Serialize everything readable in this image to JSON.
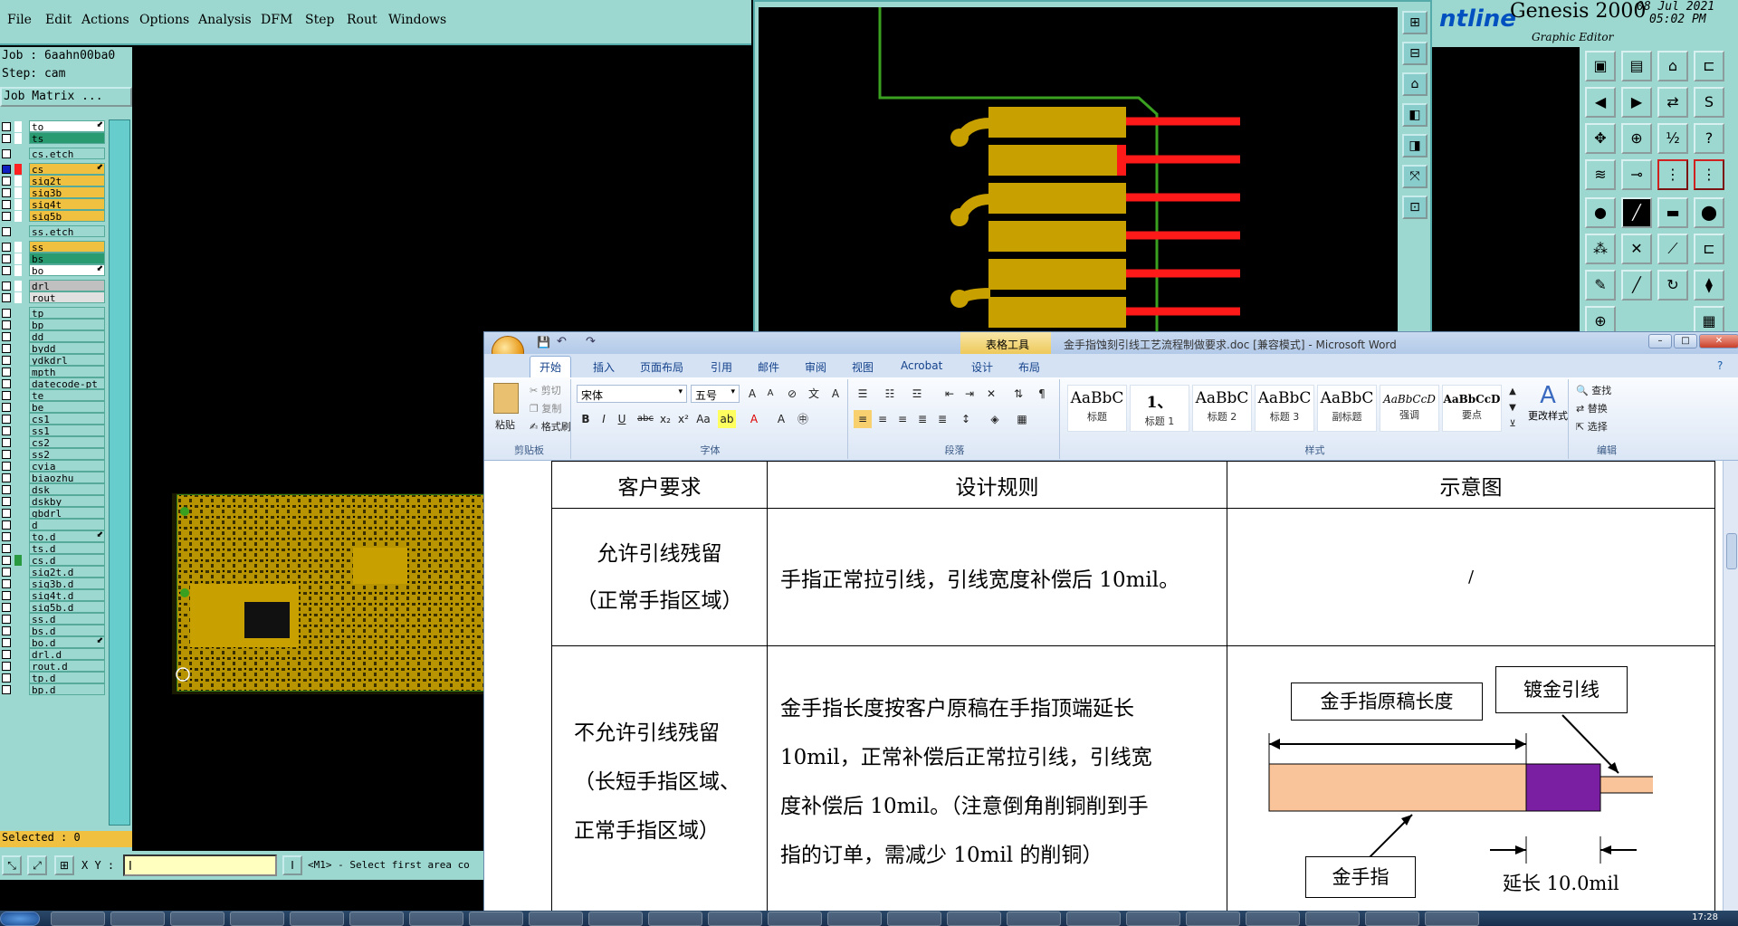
{
  "genesis": {
    "menu": [
      "File",
      "Edit",
      "Actions",
      "Options",
      "Analysis",
      "DFM",
      "Step",
      "Rout",
      "Windows"
    ],
    "job": "Job : 6aahn00ba0",
    "step": "Step: cam",
    "job_matrix": "Job Matrix ...",
    "layers": [
      {
        "name": "to",
        "bg": "#ffffff",
        "sw": "#ffffff",
        "arrow": true
      },
      {
        "name": "ts",
        "bg": "#2a9a70",
        "sw": "#ffffff"
      },
      {
        "name": "cs.etch",
        "bg": "#9cd8d0",
        "sw": "#9cd8d0"
      },
      {
        "name": "cs",
        "bg": "#f0c040",
        "sw": "#ff2020",
        "check": "#1020c0",
        "arrow": true
      },
      {
        "name": "sig2t",
        "bg": "#f0c040",
        "sw": "#ffffff"
      },
      {
        "name": "sig3b",
        "bg": "#f0c040",
        "sw": "#ffffff"
      },
      {
        "name": "sig4t",
        "bg": "#f0c040",
        "sw": "#ffffff"
      },
      {
        "name": "sig5b",
        "bg": "#f0c040",
        "sw": "#ffffff"
      },
      {
        "name": "ss.etch",
        "bg": "#9cd8d0",
        "sw": "#9cd8d0"
      },
      {
        "name": "ss",
        "bg": "#f0c040",
        "sw": "#ffffff"
      },
      {
        "name": "bs",
        "bg": "#2a9a70",
        "sw": "#ffffff"
      },
      {
        "name": "bo",
        "bg": "#ffffff",
        "sw": "#ffffff",
        "arrow": true
      },
      {
        "name": "drl",
        "bg": "#c0c0c0",
        "sw": "#ffffff"
      },
      {
        "name": "rout",
        "bg": "#e0e0e0",
        "sw": "#ffffff"
      },
      {
        "name": "tp",
        "bg": "#9cd8d0",
        "sw": "#9cd8d0"
      },
      {
        "name": "bp",
        "bg": "#9cd8d0",
        "sw": "#9cd8d0"
      },
      {
        "name": "dd",
        "bg": "#9cd8d0",
        "sw": "#9cd8d0"
      },
      {
        "name": "bydd",
        "bg": "#9cd8d0",
        "sw": "#9cd8d0"
      },
      {
        "name": "ydkdrl",
        "bg": "#9cd8d0",
        "sw": "#9cd8d0"
      },
      {
        "name": "mpth",
        "bg": "#9cd8d0",
        "sw": "#9cd8d0"
      },
      {
        "name": "datecode-pt",
        "bg": "#9cd8d0",
        "sw": "#9cd8d0"
      },
      {
        "name": "te",
        "bg": "#9cd8d0",
        "sw": "#9cd8d0"
      },
      {
        "name": "be",
        "bg": "#9cd8d0",
        "sw": "#9cd8d0"
      },
      {
        "name": "cs1",
        "bg": "#9cd8d0",
        "sw": "#9cd8d0"
      },
      {
        "name": "ss1",
        "bg": "#9cd8d0",
        "sw": "#9cd8d0"
      },
      {
        "name": "cs2",
        "bg": "#9cd8d0",
        "sw": "#9cd8d0"
      },
      {
        "name": "ss2",
        "bg": "#9cd8d0",
        "sw": "#9cd8d0"
      },
      {
        "name": "cvia",
        "bg": "#9cd8d0",
        "sw": "#9cd8d0"
      },
      {
        "name": "biaozhu",
        "bg": "#9cd8d0",
        "sw": "#9cd8d0"
      },
      {
        "name": "dsk",
        "bg": "#9cd8d0",
        "sw": "#9cd8d0"
      },
      {
        "name": "dskby",
        "bg": "#9cd8d0",
        "sw": "#9cd8d0"
      },
      {
        "name": "gbdrl",
        "bg": "#9cd8d0",
        "sw": "#9cd8d0"
      },
      {
        "name": "d",
        "bg": "#9cd8d0",
        "sw": "#9cd8d0"
      },
      {
        "name": "to.d",
        "bg": "#9cd8d0",
        "sw": "#9cd8d0",
        "arrow": true
      },
      {
        "name": "ts.d",
        "bg": "#9cd8d0",
        "sw": "#9cd8d0"
      },
      {
        "name": "cs.d",
        "bg": "#9cd8d0",
        "sw": "#2a9a40"
      },
      {
        "name": "sig2t.d",
        "bg": "#9cd8d0",
        "sw": "#9cd8d0"
      },
      {
        "name": "sig3b.d",
        "bg": "#9cd8d0",
        "sw": "#9cd8d0"
      },
      {
        "name": "sig4t.d",
        "bg": "#9cd8d0",
        "sw": "#9cd8d0"
      },
      {
        "name": "sig5b.d",
        "bg": "#9cd8d0",
        "sw": "#9cd8d0"
      },
      {
        "name": "ss.d",
        "bg": "#9cd8d0",
        "sw": "#9cd8d0"
      },
      {
        "name": "bs.d",
        "bg": "#9cd8d0",
        "sw": "#9cd8d0"
      },
      {
        "name": "bo.d",
        "bg": "#9cd8d0",
        "sw": "#9cd8d0",
        "arrow": true
      },
      {
        "name": "drl.d",
        "bg": "#9cd8d0",
        "sw": "#9cd8d0"
      },
      {
        "name": "rout.d",
        "bg": "#9cd8d0",
        "sw": "#9cd8d0"
      },
      {
        "name": "tp.d",
        "bg": "#9cd8d0",
        "sw": "#9cd8d0"
      },
      {
        "name": "bp.d",
        "bg": "#9cd8d0",
        "sw": "#9cd8d0"
      }
    ],
    "selected": "Selected : 0",
    "xy_label": "X Y :",
    "xy_value": "I",
    "mouse_hint": "<M1> - Select first area co",
    "brand_line": "ntline",
    "brand_name": "Genesis 2000",
    "brand_sub": "Graphic Editor",
    "date_line1": "08 Jul 2021",
    "date_line2": "05:02 PM",
    "colors": {
      "panel": "#9cd8d0",
      "copper": "#c8a000",
      "trace_red": "#ff1a1a",
      "outline_green": "#3aa020",
      "layer_yellow": "#f0c040"
    }
  },
  "word": {
    "window_title": "金手指蚀刻引线工艺流程制做要求.doc [兼容模式] - Microsoft Word",
    "context_tab": "表格工具",
    "tabs": [
      "开始",
      "插入",
      "页面布局",
      "引用",
      "邮件",
      "审阅",
      "视图",
      "Acrobat",
      "设计",
      "布局"
    ],
    "clipboard": {
      "paste": "粘贴",
      "cut": "剪切",
      "copy": "复制",
      "format_painter": "格式刷",
      "label": "剪贴板"
    },
    "font": {
      "name": "宋体",
      "size": "五号",
      "label": "字体"
    },
    "paragraph_label": "段落",
    "styles_label": "样式",
    "styles": [
      {
        "sample": "AaBbC",
        "name": "标题"
      },
      {
        "sample": "1、",
        "name": "标题 1"
      },
      {
        "sample": "AaBbC",
        "name": "标题 2"
      },
      {
        "sample": "AaBbC",
        "name": "标题 3"
      },
      {
        "sample": "AaBbC",
        "name": "副标题"
      },
      {
        "sample": "AaBbCcD",
        "name": "强调"
      },
      {
        "sample": "AaBbCcD",
        "name": "要点"
      }
    ],
    "change_styles": "更改样式",
    "editing": {
      "find": "查找",
      "replace": "替换",
      "select": "选择",
      "label": "编辑"
    },
    "table": {
      "headers": [
        "客户要求",
        "设计规则",
        "示意图"
      ],
      "row1": {
        "req_line1": "允许引线残留",
        "req_line2": "（正常手指区域）",
        "rule": "手指正常拉引线，引线宽度补偿后 10mil。",
        "diagram": "/"
      },
      "row2": {
        "req_line1": "不允许引线残留",
        "req_line2": "（长短手指区域、",
        "req_line3": "正常手指区域）",
        "rule_line1": "金手指长度按客户原稿在手指顶端延长",
        "rule_line2": "10mil，正常补偿后正常拉引线，引线宽",
        "rule_line3": "度补偿后 10mil。（注意倒角削铜削到手",
        "rule_line4": "指的订单，需减少 10mil 的削铜）",
        "diag_orig": "金手指原稿长度",
        "diag_plating": "镀金引线",
        "diag_finger": "金手指",
        "diag_extend": "延长 10.0mil"
      }
    }
  },
  "taskbar": {
    "clock": "17:28"
  }
}
